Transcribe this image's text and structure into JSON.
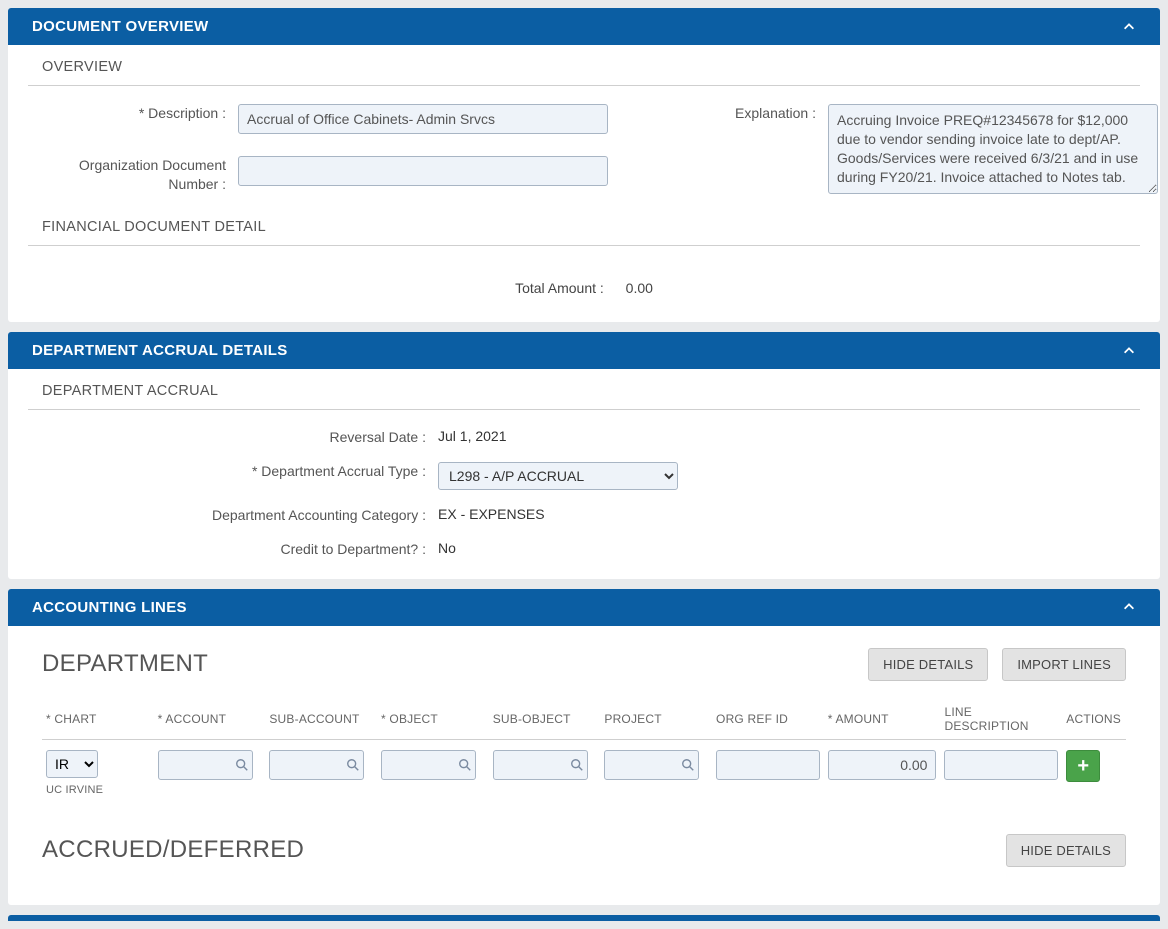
{
  "panels": {
    "overview": {
      "title": "DOCUMENT OVERVIEW",
      "sub1": "OVERVIEW",
      "desc_label": "* Description :",
      "desc_value": "Accrual of Office Cabinets- Admin Srvcs",
      "orgdoc_label": "Organization Document Number :",
      "orgdoc_value": "",
      "explanation_label": "Explanation :",
      "explanation_value": "Accruing Invoice PREQ#12345678 for $12,000 due to vendor sending invoice late to dept/AP. Goods/Services were received 6/3/21 and in use during FY20/21. Invoice attached to Notes tab.",
      "sub2": "FINANCIAL DOCUMENT DETAIL",
      "total_label": "Total Amount :",
      "total_value": "0.00"
    },
    "accrual": {
      "title": "DEPARTMENT ACCRUAL DETAILS",
      "sub": "DEPARTMENT ACCRUAL",
      "reversal_label": "Reversal Date :",
      "reversal_value": "Jul 1, 2021",
      "type_label": "* Department Accrual Type :",
      "type_value": "L298 - A/P ACCRUAL",
      "category_label": "Department Accounting Category :",
      "category_value": "EX - EXPENSES",
      "credit_label": "Credit to Department? :",
      "credit_value": "No"
    },
    "lines": {
      "title": "ACCOUNTING LINES",
      "section1": "DEPARTMENT",
      "hide_details": "HIDE DETAILS",
      "import_lines": "IMPORT LINES",
      "headers": {
        "chart": "* CHART",
        "account": "* ACCOUNT",
        "sub_account": "SUB-ACCOUNT",
        "object": "* OBJECT",
        "sub_object": "SUB-OBJECT",
        "project": "PROJECT",
        "org_ref": "ORG REF ID",
        "amount": "* AMOUNT",
        "line_desc": "LINE DESCRIPTION",
        "actions": "ACTIONS"
      },
      "row": {
        "chart_value": "IR",
        "chart_sub": "UC IRVINE",
        "amount_value": "0.00"
      },
      "section2": "ACCRUED/DEFERRED"
    }
  }
}
